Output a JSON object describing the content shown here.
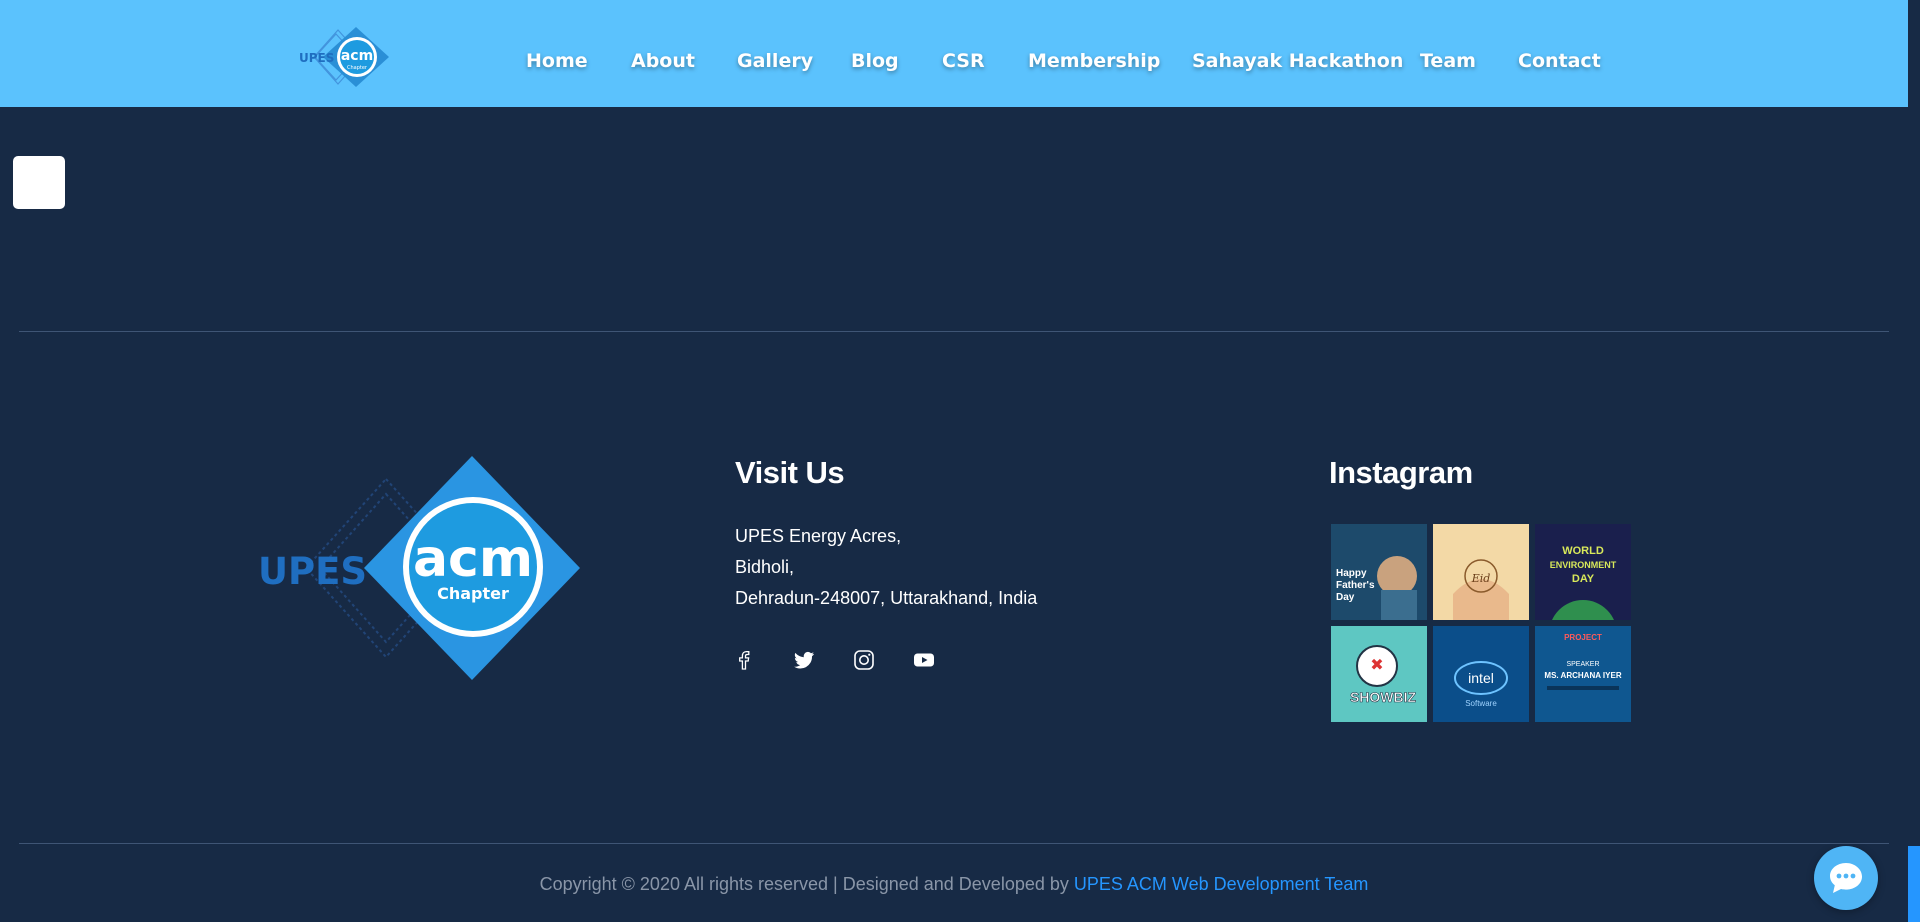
{
  "header": {
    "logo": {
      "text_left": "UPES",
      "text_circle": "acm",
      "text_sub": "Chapter"
    },
    "nav": [
      {
        "label": "Home"
      },
      {
        "label": "About"
      },
      {
        "label": "Gallery"
      },
      {
        "label": "Blog"
      },
      {
        "label": "CSR"
      },
      {
        "label": "Membership"
      },
      {
        "label": "Sahayak Hackathon"
      },
      {
        "label": "Team"
      },
      {
        "label": "Contact"
      }
    ]
  },
  "footer": {
    "logo": {
      "text_left": "UPES",
      "text_circle": "acm",
      "text_sub": "Chapter"
    },
    "visit": {
      "title": "Visit Us",
      "address": [
        "UPES Energy Acres,",
        "Bidholi,",
        "Dehradun-248007, Uttarakhand, India"
      ]
    },
    "social_icons": [
      "facebook-icon",
      "twitter-icon",
      "instagram-icon",
      "youtube-icon"
    ],
    "instagram": {
      "title": "Instagram",
      "tiles": [
        {
          "caption": "Happy Father's Day",
          "bg": "#1d4a6b"
        },
        {
          "caption": "Eid Mubarak",
          "bg": "#f3d9a6"
        },
        {
          "caption": "WORLD ENVIRONMENT DAY",
          "bg": "#1a1f4d"
        },
        {
          "caption": "SHOWBIZ",
          "bg": "#5ec7c2"
        },
        {
          "caption": "intel Software",
          "bg": "#0b4e8a"
        },
        {
          "caption": "MS. ARCHANA IYER",
          "bg": "#0f5790"
        }
      ]
    },
    "copyright_text": "Copyright © 2020 All rights reserved | Designed and Developed by",
    "copyright_link": "UPES ACM Web Development Team"
  },
  "colors": {
    "header_bg": "#5bc2fd",
    "page_bg": "#172a45",
    "link": "#2596ff",
    "chat": "#4fb5f5"
  }
}
